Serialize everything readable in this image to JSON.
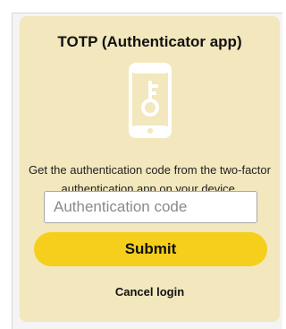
{
  "card": {
    "title": "TOTP (Authenticator app)",
    "icon": "phone-key-icon",
    "instructions": "Get the authentication code from the two-factor authentication app on your device.",
    "code_input": {
      "value": "",
      "placeholder": "Authentication code"
    },
    "submit_label": "Submit",
    "cancel_label": "Cancel login"
  },
  "colors": {
    "card_background": "#f2e7bd",
    "submit_background": "#f5cf1b",
    "icon_color": "#ffffff"
  }
}
